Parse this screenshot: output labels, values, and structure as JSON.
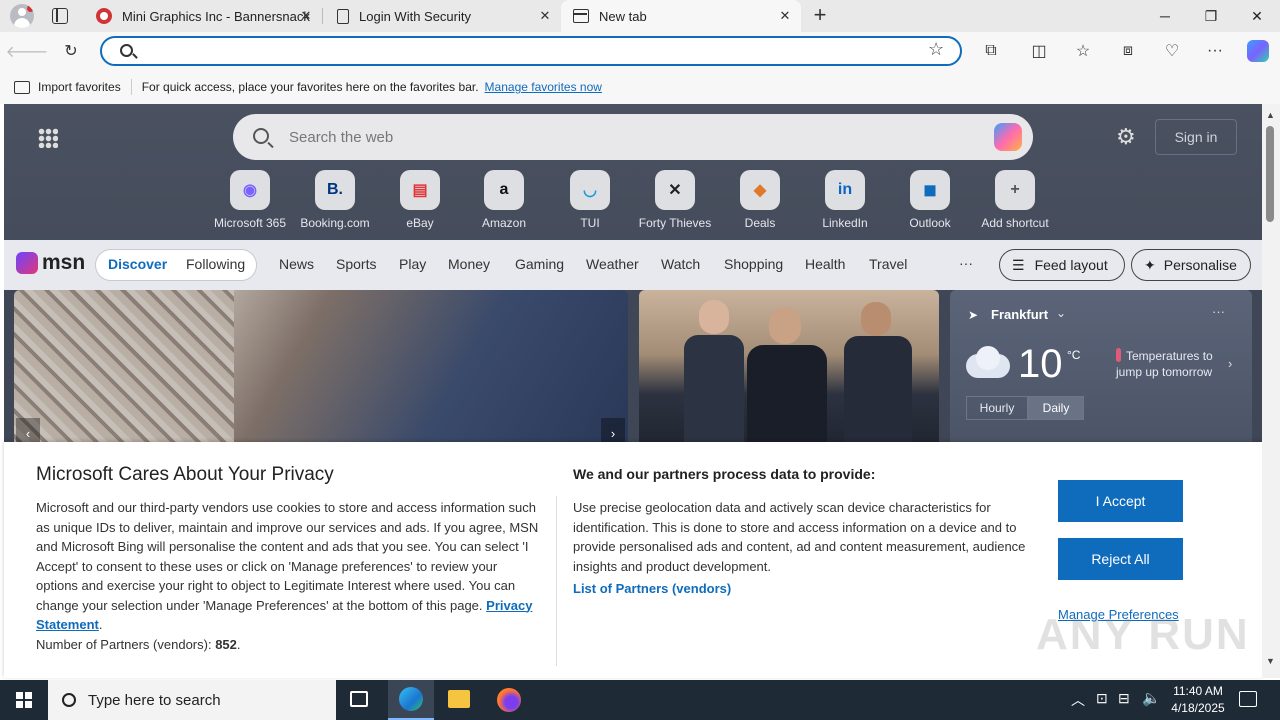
{
  "tabs": [
    {
      "title": "Mini Graphics Inc - Bannersnack",
      "favicon": "bannersnack-icon"
    },
    {
      "title": "Login With Security",
      "favicon": "page-icon"
    },
    {
      "title": "New tab",
      "favicon": "newtab-icon",
      "active": true
    }
  ],
  "address_bar": {
    "value": "",
    "placeholder": ""
  },
  "favorites_bar": {
    "import_label": "Import favorites",
    "hint": "For quick access, place your favorites here on the favorites bar.",
    "manage_link": "Manage favorites now"
  },
  "ntp": {
    "search_placeholder": "Search the web",
    "sign_in": "Sign in",
    "shortcuts": [
      {
        "label": "Microsoft 365",
        "glyph": "◉",
        "color": "#7b61ff"
      },
      {
        "label": "Booking.com",
        "glyph": "B.",
        "color": "#003580"
      },
      {
        "label": "eBay",
        "glyph": "▤",
        "color": "#e53238"
      },
      {
        "label": "Amazon",
        "glyph": "a",
        "color": "#111111"
      },
      {
        "label": "TUI",
        "glyph": "◡",
        "color": "#1a9ad6"
      },
      {
        "label": "Forty Thieves",
        "glyph": "✕",
        "color": "#222222"
      },
      {
        "label": "Deals",
        "glyph": "◆",
        "color": "#e0792b"
      },
      {
        "label": "LinkedIn",
        "glyph": "in",
        "color": "#0a66c2"
      },
      {
        "label": "Outlook",
        "glyph": "◼",
        "color": "#0f6cbd"
      },
      {
        "label": "Add shortcut",
        "glyph": "+",
        "color": "#555555"
      }
    ]
  },
  "msn": {
    "logo": "msn",
    "nav": [
      "Discover",
      "Following",
      "News",
      "Sports",
      "Play",
      "Money",
      "Gaming",
      "Weather",
      "Watch",
      "Shopping",
      "Health",
      "Travel"
    ],
    "more": "···",
    "feed_layout": "Feed layout",
    "personalise": "Personalise"
  },
  "weather": {
    "location": "Frankfurt",
    "temp": "10",
    "unit": "°C",
    "note": "Temperatures to jump up tomorrow",
    "tab_hourly": "Hourly",
    "tab_daily": "Daily"
  },
  "privacy": {
    "title": "Microsoft Cares About Your Privacy",
    "body": "Microsoft and our third-party vendors use cookies to store and access information such as unique IDs to deliver, maintain and improve our services and ads. If you agree, MSN and Microsoft Bing will personalise the content and ads that you see. You can select 'I Accept' to consent to these uses or click on 'Manage preferences' to review your options and exercise your right to object to Legitimate Interest where used.  You can change your selection under 'Manage Preferences' at the bottom of this page.",
    "privacy_link": "Privacy Statement",
    "partners_prefix": "Number of Partners (vendors):",
    "partners_count": "852",
    "right_title": "We and our partners process data to provide:",
    "right_desc": "Use precise geolocation data and actively scan device characteristics for identification. This is done to store and access information on a device and to provide personalised ads and content, ad and content measurement, audience insights and product development.",
    "list_partners": "List of Partners (vendors)",
    "accept": "I Accept",
    "reject": "Reject All",
    "manage": "Manage Preferences"
  },
  "watermark": "ANY RUN",
  "taskbar": {
    "search_placeholder": "Type here to search",
    "time": "11:40 AM",
    "date": "4/18/2025"
  }
}
